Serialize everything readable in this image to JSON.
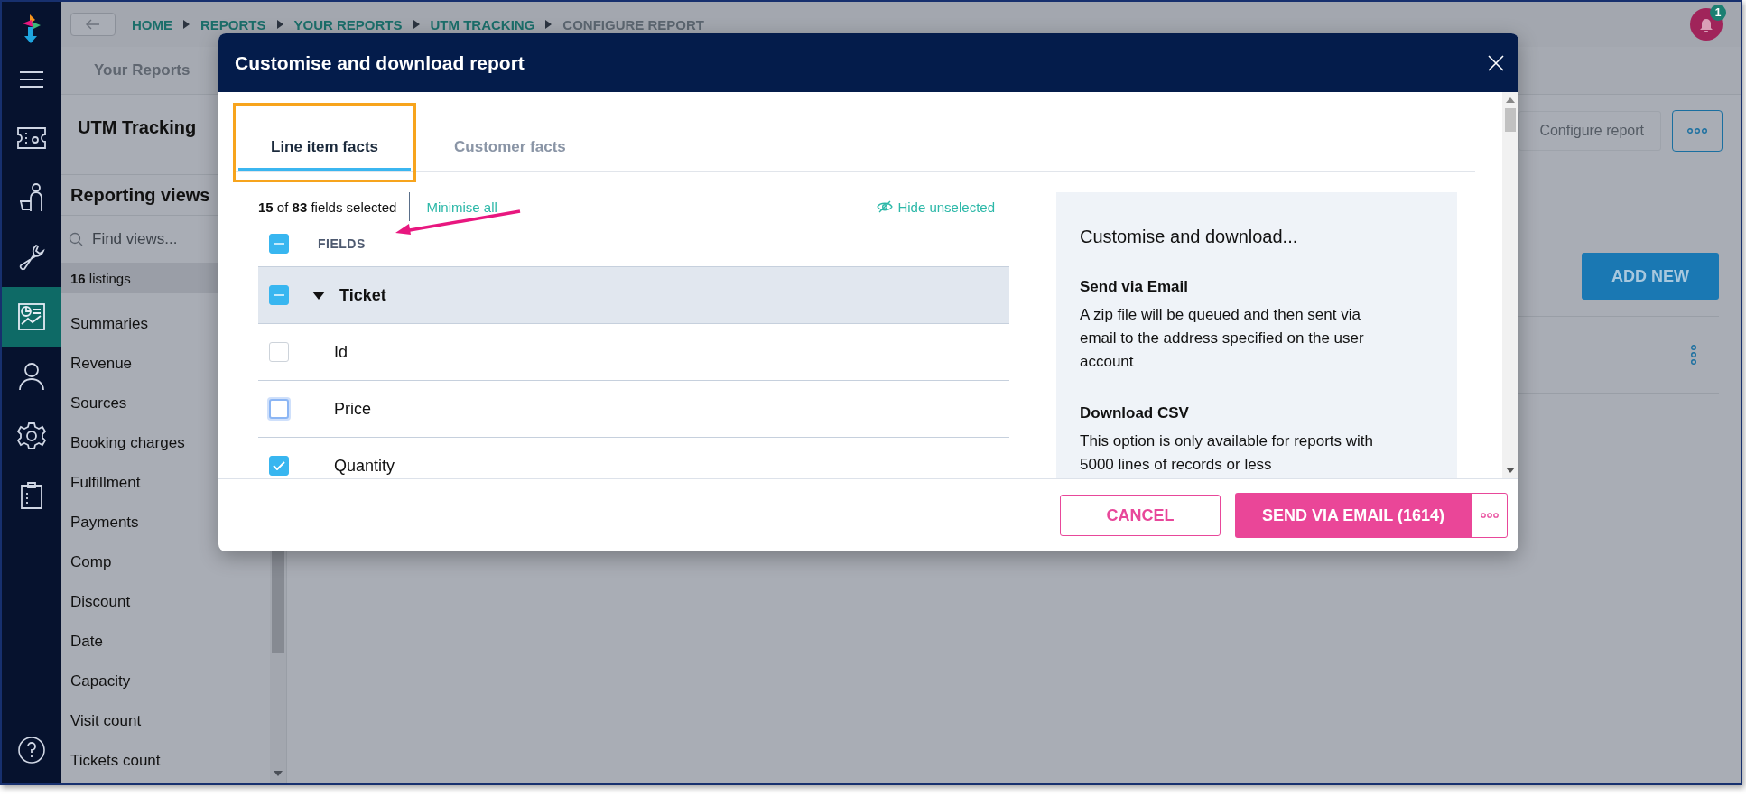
{
  "breadcrumbs": [
    {
      "label": "HOME",
      "current": false
    },
    {
      "label": "REPORTS",
      "current": false
    },
    {
      "label": "YOUR REPORTS",
      "current": false
    },
    {
      "label": "UTM TRACKING",
      "current": false
    },
    {
      "label": "CONFIGURE REPORT",
      "current": true
    }
  ],
  "notification": {
    "count": "1"
  },
  "rail": [
    {
      "kind": "ticket",
      "selected": false
    },
    {
      "kind": "visitor",
      "selected": false
    },
    {
      "kind": "wrench",
      "selected": false
    },
    {
      "kind": "report",
      "selected": true
    },
    {
      "kind": "person",
      "selected": false
    },
    {
      "kind": "gear",
      "selected": false
    },
    {
      "kind": "clipboard",
      "selected": false
    }
  ],
  "page_tab": "Your Reports",
  "report_title": "UTM Tracking",
  "configure_button": "Configure report",
  "add_new_button": "ADD NEW",
  "sidebar": {
    "title": "Reporting views",
    "search_placeholder": "Find views...",
    "listing_count": "**16** listings",
    "items": [
      "Summaries",
      "Revenue",
      "Sources",
      "Booking charges",
      "Fulfillment",
      "Payments",
      "Comp",
      "Discount",
      "Date",
      "Capacity",
      "Visit count",
      "Tickets count"
    ]
  },
  "modal": {
    "title": "Customise and download report",
    "tabs": [
      {
        "label": "Line item facts",
        "selected": true,
        "highlighted": true
      },
      {
        "label": "Customer facts",
        "selected": false,
        "highlighted": false
      }
    ],
    "selection_summary": "**15** of **83** fields selected",
    "minimise_link": "Minimise all",
    "hide_link": "Hide unselected",
    "fields_header": {
      "label": "FIELDS",
      "indeterminate": true,
      "arrow_annotation": true
    },
    "groups": [
      {
        "label": "Ticket",
        "expanded": true,
        "indeterminate": true,
        "children": [
          {
            "label": "Id",
            "checked": false,
            "focused": false
          },
          {
            "label": "Price",
            "checked": false,
            "focused": true
          },
          {
            "label": "Quantity",
            "checked": true,
            "focused": false
          }
        ]
      }
    ],
    "info": {
      "title": "Customise and download...",
      "sections": [
        {
          "heading": "Send via Email",
          "text": "A zip file will be queued and then sent via email to the address specified on the user account"
        },
        {
          "heading": "Download CSV",
          "text": "This option is only available for reports with 5000 lines of records or less"
        }
      ]
    },
    "cancel_button": "CANCEL",
    "send_button": "SEND VIA EMAIL (1614)"
  }
}
